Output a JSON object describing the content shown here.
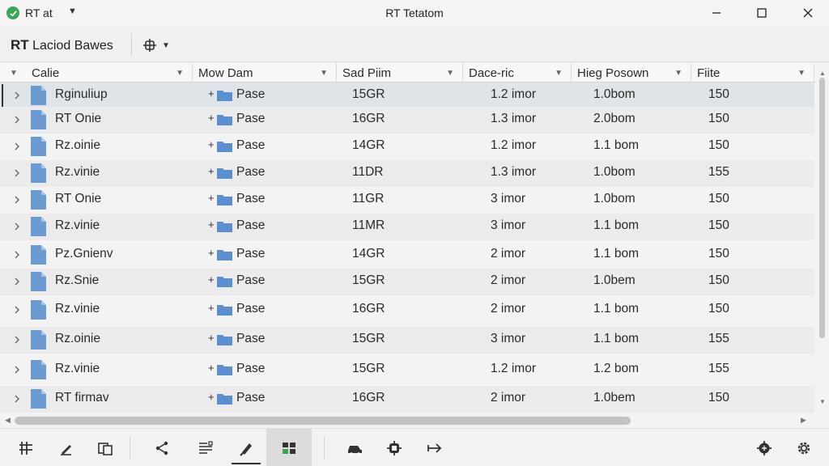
{
  "window": {
    "app_name": "RT at",
    "title": "RT Tetatom"
  },
  "toolbar": {
    "location_prefix": "RT",
    "location_name": "Laciod Bawes"
  },
  "columns": [
    {
      "label": "Calie"
    },
    {
      "label": "Mow Dam"
    },
    {
      "label": "Sad Piim"
    },
    {
      "label": "Dace-ric"
    },
    {
      "label": "Hieg Posown"
    },
    {
      "label": "Fiite"
    }
  ],
  "rows": [
    {
      "name": "Rginuliup",
      "type": "Pase",
      "size": "15GR",
      "date": "1.2 imor",
      "hp": "1.0bom",
      "file": "150"
    },
    {
      "name": "RT Onie",
      "type": "Pase",
      "size": "16GR",
      "date": "1.3 imor",
      "hp": "2.0bom",
      "file": "150"
    },
    {
      "name": "Rz.oinie",
      "type": "Pase",
      "size": "14GR",
      "date": "1.2 imor",
      "hp": "1.1 bom",
      "file": "150"
    },
    {
      "name": "Rz.vinie",
      "type": "Pase",
      "size": "11DR",
      "date": "1.3 imor",
      "hp": "1.0bom",
      "file": "155"
    },
    {
      "name": "RT Onie",
      "type": "Pase",
      "size": "11GR",
      "date": "3 imor",
      "hp": "1.0bom",
      "file": "150"
    },
    {
      "name": "Rz.vinie",
      "type": "Pase",
      "size": "11MR",
      "date": "3 imor",
      "hp": "1.1 bom",
      "file": "150"
    },
    {
      "name": "Pz.Gnienv",
      "type": "Pase",
      "size": "14GR",
      "date": "2 imor",
      "hp": "1.1 bom",
      "file": "150"
    },
    {
      "name": "Rz.Snie",
      "type": "Pase",
      "size": "15GR",
      "date": "2 imor",
      "hp": "1.0bem",
      "file": "150"
    },
    {
      "name": "Rz.vinie",
      "type": "Pase",
      "size": "16GR",
      "date": "2 imor",
      "hp": "1.1 bom",
      "file": "150"
    },
    {
      "name": "Rz.oinie",
      "type": "Pase",
      "size": "15GR",
      "date": "3 imor",
      "hp": "1.1 bom",
      "file": "155"
    },
    {
      "name": "Rz.vinie",
      "type": "Pase",
      "size": "15GR",
      "date": "1.2 imor",
      "hp": "1.2 bom",
      "file": "155"
    },
    {
      "name": "RT firmav",
      "type": "Pase",
      "size": "16GR",
      "date": "2 imor",
      "hp": "1.0bem",
      "file": "150"
    }
  ],
  "colors": {
    "app_icon": "#3aa655",
    "file_icon": "#6b9bd0",
    "folder_icon": "#5a8fd0",
    "selected_row": "#dfe4e8"
  }
}
